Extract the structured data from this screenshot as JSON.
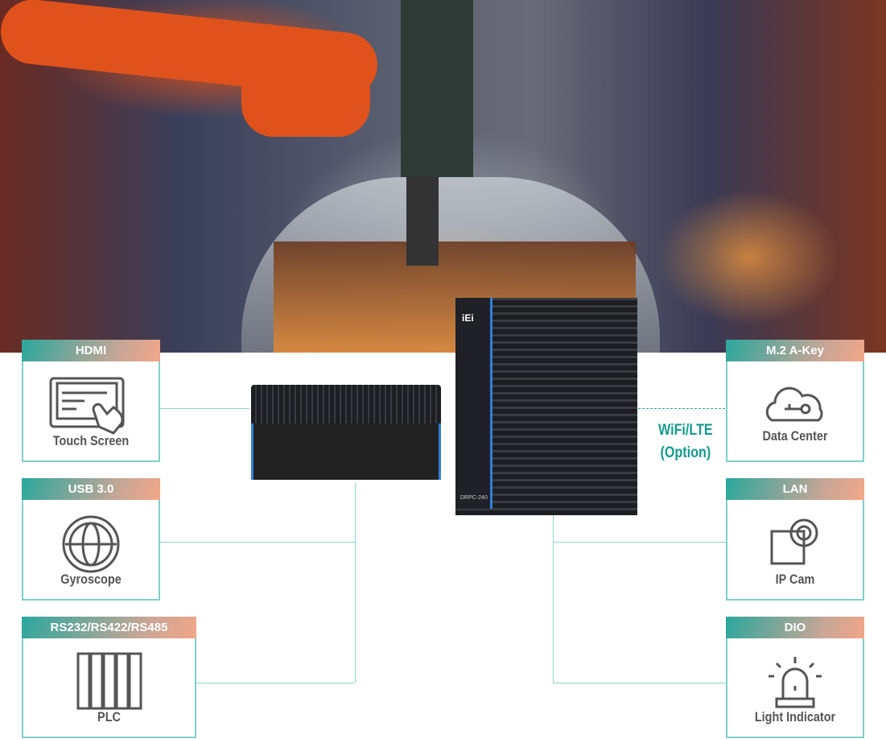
{
  "left_boxes": [
    {
      "header": "HDMI",
      "label": "Touch Screen",
      "icon": "touch-screen-icon"
    },
    {
      "header": "USB 3.0",
      "label": "Gyroscope",
      "icon": "gyroscope-icon"
    },
    {
      "header": "RS232/RS422/RS485",
      "label": "PLC",
      "icon": "plc-icon"
    }
  ],
  "right_boxes": [
    {
      "header": "M.2 A-Key",
      "label": "Data Center",
      "icon": "cloud-key-icon"
    },
    {
      "header": "LAN",
      "label": "IP Cam",
      "icon": "ip-camera-icon"
    },
    {
      "header": "DIO",
      "label": "Light Indicator",
      "icon": "warning-light-icon"
    }
  ],
  "wifi": {
    "line1": "WiFi/LTE",
    "line2": "(Option)"
  },
  "device": {
    "brand": "iEi",
    "model": "DRPC-240"
  },
  "colors": {
    "teal": "#2aa79c",
    "peach": "#f3a688",
    "line": "#8fd3cc",
    "text": "#555555"
  }
}
